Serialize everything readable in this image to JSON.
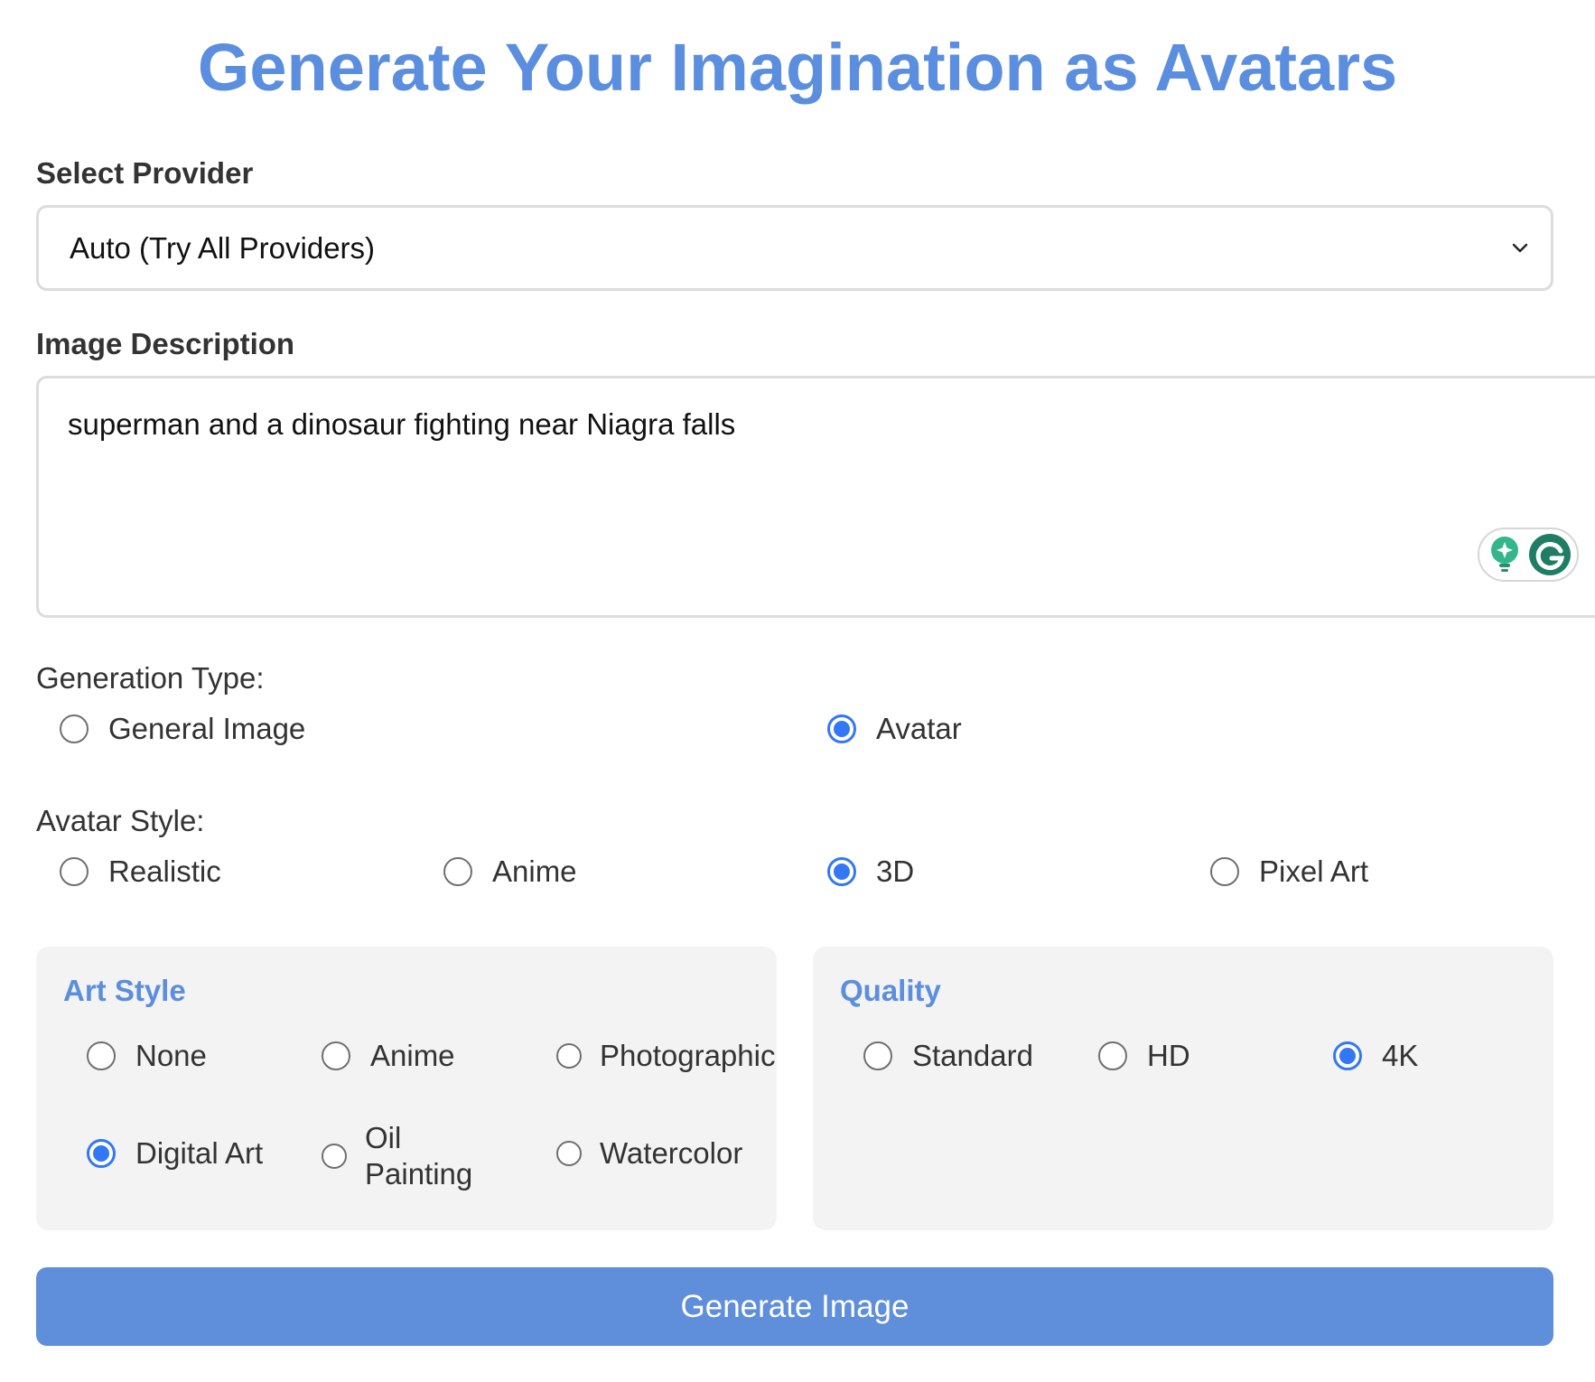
{
  "header": {
    "title": "Generate Your Imagination as Avatars"
  },
  "provider": {
    "label": "Select Provider",
    "selected": "Auto (Try All Providers)"
  },
  "description": {
    "label": "Image Description",
    "value": "superman and a dinosaur fighting near Niagra falls"
  },
  "generation_type": {
    "label": "Generation Type:",
    "options": [
      {
        "label": "General Image",
        "checked": false
      },
      {
        "label": "Avatar",
        "checked": true
      }
    ]
  },
  "avatar_style": {
    "label": "Avatar Style:",
    "options": [
      {
        "label": "Realistic",
        "checked": false
      },
      {
        "label": "Anime",
        "checked": false
      },
      {
        "label": "3D",
        "checked": true
      },
      {
        "label": "Pixel Art",
        "checked": false
      }
    ]
  },
  "art_style": {
    "title": "Art Style",
    "options": [
      {
        "label": "None",
        "checked": false
      },
      {
        "label": "Anime",
        "checked": false
      },
      {
        "label": "Photographic",
        "checked": false
      },
      {
        "label": "Digital Art",
        "checked": true
      },
      {
        "label_line1": "Oil",
        "label_line2": "Painting",
        "checked": false
      },
      {
        "label": "Watercolor",
        "checked": false
      }
    ]
  },
  "quality": {
    "title": "Quality",
    "options": [
      {
        "label": "Standard",
        "checked": false
      },
      {
        "label": "HD",
        "checked": false
      },
      {
        "label": "4K",
        "checked": true
      }
    ]
  },
  "actions": {
    "generate_label": "Generate Image"
  },
  "icons": {
    "dropdown": "chevron-down-icon",
    "grammarly_assist": "lightbulb-icon",
    "grammarly": "grammarly-g-icon"
  },
  "colors": {
    "accent": "#5b8ede",
    "radio_checked": "#3477f5",
    "button": "#5f8fda",
    "panel_bg": "#f3f3f3"
  }
}
